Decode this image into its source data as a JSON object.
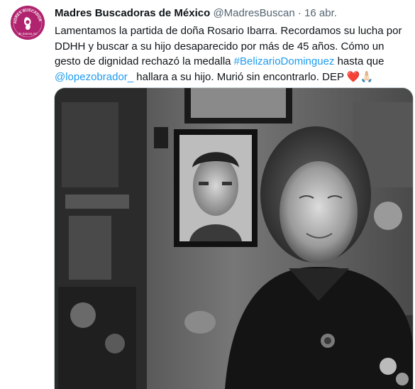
{
  "account": {
    "display_name": "Madres Buscadoras de México",
    "handle": "@MadresBuscan",
    "separator": "·",
    "date": "16 abr.",
    "avatar_text_top": "MADRES BUSCADORAS",
    "avatar_text_bottom": "de Sonora AC"
  },
  "tweet": {
    "text_before_hashtag": "Lamentamos la partida de doña Rosario Ibarra. Recordamos su lucha por DDHH y buscar a su hijo desaparecido por más de 45 años. Cómo un gesto de dignidad rechazó la medalla ",
    "hashtag": "#BelizarioDominguez",
    "text_mid": " hasta que ",
    "mention": "@lopezobrador_",
    "text_after": " hallara a su hijo. Murió sin encontrarlo. DEP ",
    "emoji_heart": "❤️",
    "emoji_pray": "🙏🏻"
  },
  "media": {
    "description_icon": "black-and-white-photo",
    "colors": {
      "accent_link": "#1d9bf0",
      "avatar_bg": "#b0236e"
    }
  }
}
